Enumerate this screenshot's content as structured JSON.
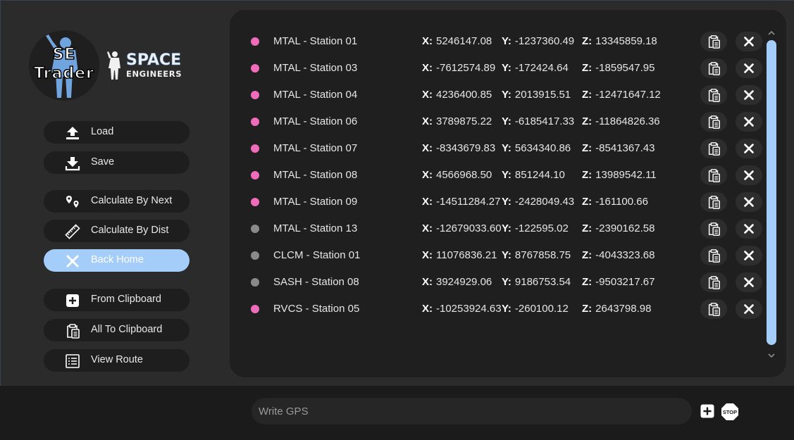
{
  "logo": {
    "app_line1": "SE",
    "app_line2": "Trader",
    "game_line1": "SPACE",
    "game_line2": "ENGINEERS"
  },
  "sidebar": {
    "buttons": [
      {
        "label": "Load",
        "icon": "upload-icon"
      },
      {
        "label": "Save",
        "icon": "download-icon"
      },
      {
        "label": "Calculate By Next",
        "icon": "waypoints-icon"
      },
      {
        "label": "Calculate By Dist",
        "icon": "ruler-icon"
      },
      {
        "label": "Back Home",
        "icon": "close-icon",
        "active": true
      },
      {
        "label": "From Clipboard",
        "icon": "plus-square-icon"
      },
      {
        "label": "All To Clipboard",
        "icon": "clipboard-icon"
      },
      {
        "label": "View Route",
        "icon": "list-icon"
      }
    ]
  },
  "labels": {
    "x": "X:",
    "y": "Y:",
    "z": "Z:"
  },
  "colors": {
    "pink": "#ef6cba",
    "gray": "#8a8a8a",
    "accent": "#a5cdf9"
  },
  "stations": [
    {
      "name": "MTAL - Station 01",
      "color": "pink",
      "x": "5246147.08",
      "y": "-1237360.49",
      "z": "13345859.18"
    },
    {
      "name": "MTAL - Station 03",
      "color": "pink",
      "x": "-7612574.89",
      "y": "-172424.64",
      "z": "-1859547.95"
    },
    {
      "name": "MTAL - Station 04",
      "color": "pink",
      "x": "4236400.85",
      "y": "2013915.51",
      "z": "-12471647.12"
    },
    {
      "name": "MTAL - Station 06",
      "color": "pink",
      "x": "3789875.22",
      "y": "-6185417.33",
      "z": "-11864826.36"
    },
    {
      "name": "MTAL - Station 07",
      "color": "pink",
      "x": "-8343679.83",
      "y": "5634340.86",
      "z": "-8541367.43"
    },
    {
      "name": "MTAL - Station 08",
      "color": "pink",
      "x": "4566968.50",
      "y": "851244.10",
      "z": "13989542.11"
    },
    {
      "name": "MTAL - Station 09",
      "color": "pink",
      "x": "-14511284.27",
      "y": "-2428049.43",
      "z": "-161100.66"
    },
    {
      "name": "MTAL - Station 13",
      "color": "gray",
      "x": "-12679033.60",
      "y": "-122595.02",
      "z": "-2390162.58"
    },
    {
      "name": "CLCM - Station 01",
      "color": "gray",
      "x": "11076836.21",
      "y": "8767858.75",
      "z": "-4043323.68"
    },
    {
      "name": "SASH - Station 08",
      "color": "gray",
      "x": "3924929.06",
      "y": "9186753.54",
      "z": "-9503217.67"
    },
    {
      "name": "RVCS - Station 05",
      "color": "pink",
      "x": "-10253924.63",
      "y": "-260100.12",
      "z": "2643798.98"
    }
  ],
  "gps_input": {
    "placeholder": "Write GPS",
    "value": ""
  },
  "stop_label": "STOP"
}
